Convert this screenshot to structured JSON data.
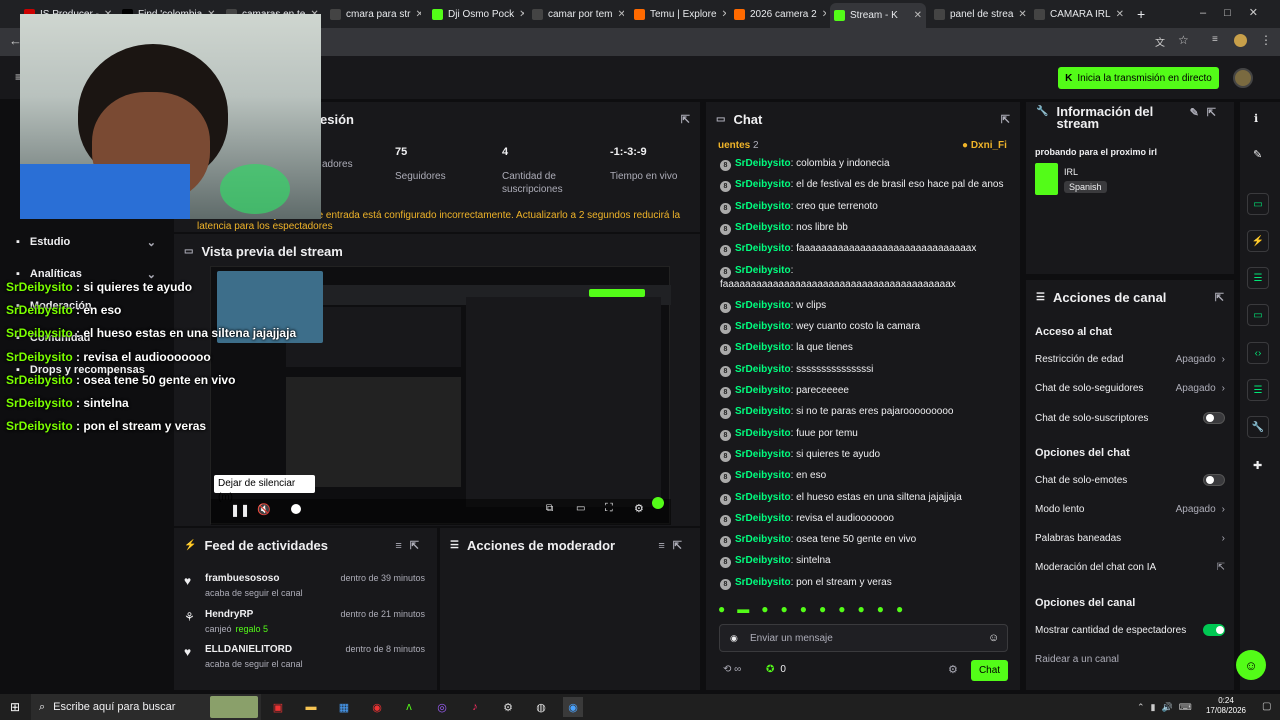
{
  "browser": {
    "tabs": [
      {
        "label": "IS Producer -",
        "fav": "#cc0000"
      },
      {
        "label": "Find 'colombia",
        "fav": "#000"
      },
      {
        "label": "camaras en te",
        "fav": "#444"
      },
      {
        "label": "cmara para str",
        "fav": "#444"
      },
      {
        "label": "Dji Osmo Pock",
        "fav": "#53fc18"
      },
      {
        "label": "camar por tem",
        "fav": "#444"
      },
      {
        "label": "Temu | Explore",
        "fav": "#ff6a00"
      },
      {
        "label": "2026 camera 2",
        "fav": "#ff6a00"
      },
      {
        "label": "Stream - K",
        "fav": "#53fc18"
      },
      {
        "label": "panel de strea",
        "fav": "#444"
      },
      {
        "label": "CAMARA IRL",
        "fav": "#444"
      }
    ],
    "new_tab": "+"
  },
  "header": {
    "go_live": "Inicia la transmisión en directo"
  },
  "session": {
    "title": "esión",
    "stats": [
      {
        "value": "",
        "label": "adores"
      },
      {
        "value": "75",
        "label": "Seguidores"
      },
      {
        "value": "4",
        "label": "Cantidad de suscripciones"
      },
      {
        "value": "-1:-3:-9",
        "label": "Tiempo en vivo"
      }
    ],
    "warning": "El intervalo de keyframes de entrada está configurado incorrectamente. Actualizarlo a 2 segundos reducirá la latencia para los espectadores"
  },
  "left_nav": [
    {
      "label": "Estudio"
    },
    {
      "label": "Analíticas"
    },
    {
      "label": "Moderación"
    },
    {
      "label": "Comunidad"
    },
    {
      "label": "Drops y recompensas"
    }
  ],
  "overlay_chat": [
    {
      "user": "SrDeibysito",
      "text": " : si quieres te ayudo"
    },
    {
      "user": "SrDeibysito",
      "text": " : en eso"
    },
    {
      "user": "SrDeibysito",
      "text": " : el hueso estas en una siltena jajajjaja"
    },
    {
      "user": "SrDeibysito",
      "text": " : revisa el audiooooooo"
    },
    {
      "user": "SrDeibysito",
      "text": " : osea tene 50 gente en vivo"
    },
    {
      "user": "SrDeibysito",
      "text": " : sintelna"
    },
    {
      "user": "SrDeibysito",
      "text": " : pon el stream y veras"
    }
  ],
  "preview": {
    "title": "Vista previa del stream",
    "tooltip": "Dejar de silenciar (m)"
  },
  "activity": {
    "title": "Feed de actividades",
    "items": [
      {
        "name": "frambuesososo",
        "detail": "acaba de seguir el canal",
        "extra": "",
        "time": "dentro de 39 minutos"
      },
      {
        "name": "HendryRP",
        "detail": "canjeó",
        "extra": "regalo 5",
        "time": "dentro de 21 minutos"
      },
      {
        "name": "ELLDANIELITORD",
        "detail": "acaba de seguir el canal",
        "extra": "",
        "time": "dentro de 8 minutos"
      }
    ]
  },
  "mod_actions": {
    "title": "Acciones de moderador"
  },
  "chat": {
    "title": "Chat",
    "pinned_left": "uentes",
    "pinned_count": "2",
    "pinned_right": "Dxni_Fi",
    "messages": [
      {
        "user": "SrDeibysito",
        "text": "colombia y indonecia"
      },
      {
        "user": "SrDeibysito",
        "text": "el de festival es de brasil eso hace pal de anos"
      },
      {
        "user": "SrDeibysito",
        "text": "creo que terrenoto"
      },
      {
        "user": "SrDeibysito",
        "text": "nos libre bb"
      },
      {
        "user": "SrDeibysito",
        "text": "faaaaaaaaaaaaaaaaaaaaaaaaaaaaaaax"
      },
      {
        "user": "SrDeibysito",
        "text": ""
      },
      {
        "user": "",
        "text": "faaaaaaaaaaaaaaaaaaaaaaaaaaaaaaaaaaaaaaaaax"
      },
      {
        "user": "SrDeibysito",
        "text": "w clips"
      },
      {
        "user": "SrDeibysito",
        "text": "wey cuanto costo la camara"
      },
      {
        "user": "SrDeibysito",
        "text": "la que tienes"
      },
      {
        "user": "SrDeibysito",
        "text": "sssssssssssssssi"
      },
      {
        "user": "SrDeibysito",
        "text": "pareceeeee"
      },
      {
        "user": "SrDeibysito",
        "text": "si no te paras eres pajarooooooooo"
      },
      {
        "user": "SrDeibysito",
        "text": "fuue por temu"
      },
      {
        "user": "SrDeibysito",
        "text": "si quieres te ayudo"
      },
      {
        "user": "SrDeibysito",
        "text": "en eso"
      },
      {
        "user": "SrDeibysito",
        "text": "el hueso estas en una siltena jajajjaja"
      },
      {
        "user": "SrDeibysito",
        "text": "revisa el audiooooooo"
      },
      {
        "user": "SrDeibysito",
        "text": "osea tene 50 gente en vivo"
      },
      {
        "user": "SrDeibysito",
        "text": "sintelna"
      },
      {
        "user": "SrDeibysito",
        "text": "pon el stream y veras"
      }
    ],
    "input_placeholder": "Enviar un mensaje",
    "points": "0",
    "send": "Chat"
  },
  "stream_info": {
    "title": "Información del stream",
    "stream_title": "probando para el proximo irl",
    "category": "IRL",
    "language": "Spanish"
  },
  "channel_actions": {
    "title": "Acciones de canal",
    "chat_access": "Acceso al chat",
    "age": {
      "label": "Restricción de edad",
      "value": "Apagado"
    },
    "followers": {
      "label": "Chat de solo-seguidores",
      "value": "Apagado"
    },
    "subs": {
      "label": "Chat de solo-suscriptores"
    },
    "chat_options": "Opciones del chat",
    "emotes": {
      "label": "Chat de solo-emotes"
    },
    "slow": {
      "label": "Modo lento",
      "value": "Apagado"
    },
    "banned": {
      "label": "Palabras baneadas"
    },
    "ai": {
      "label": "Moderación del chat con IA"
    },
    "channel_options": "Opciones del canal",
    "viewers": {
      "label": "Mostrar cantidad de espectadores"
    },
    "raid": {
      "label": "Raidear a un canal"
    }
  },
  "taskbar": {
    "search": "Escribe aquí para buscar",
    "time": "0:24",
    "date": "17/08/2026"
  }
}
